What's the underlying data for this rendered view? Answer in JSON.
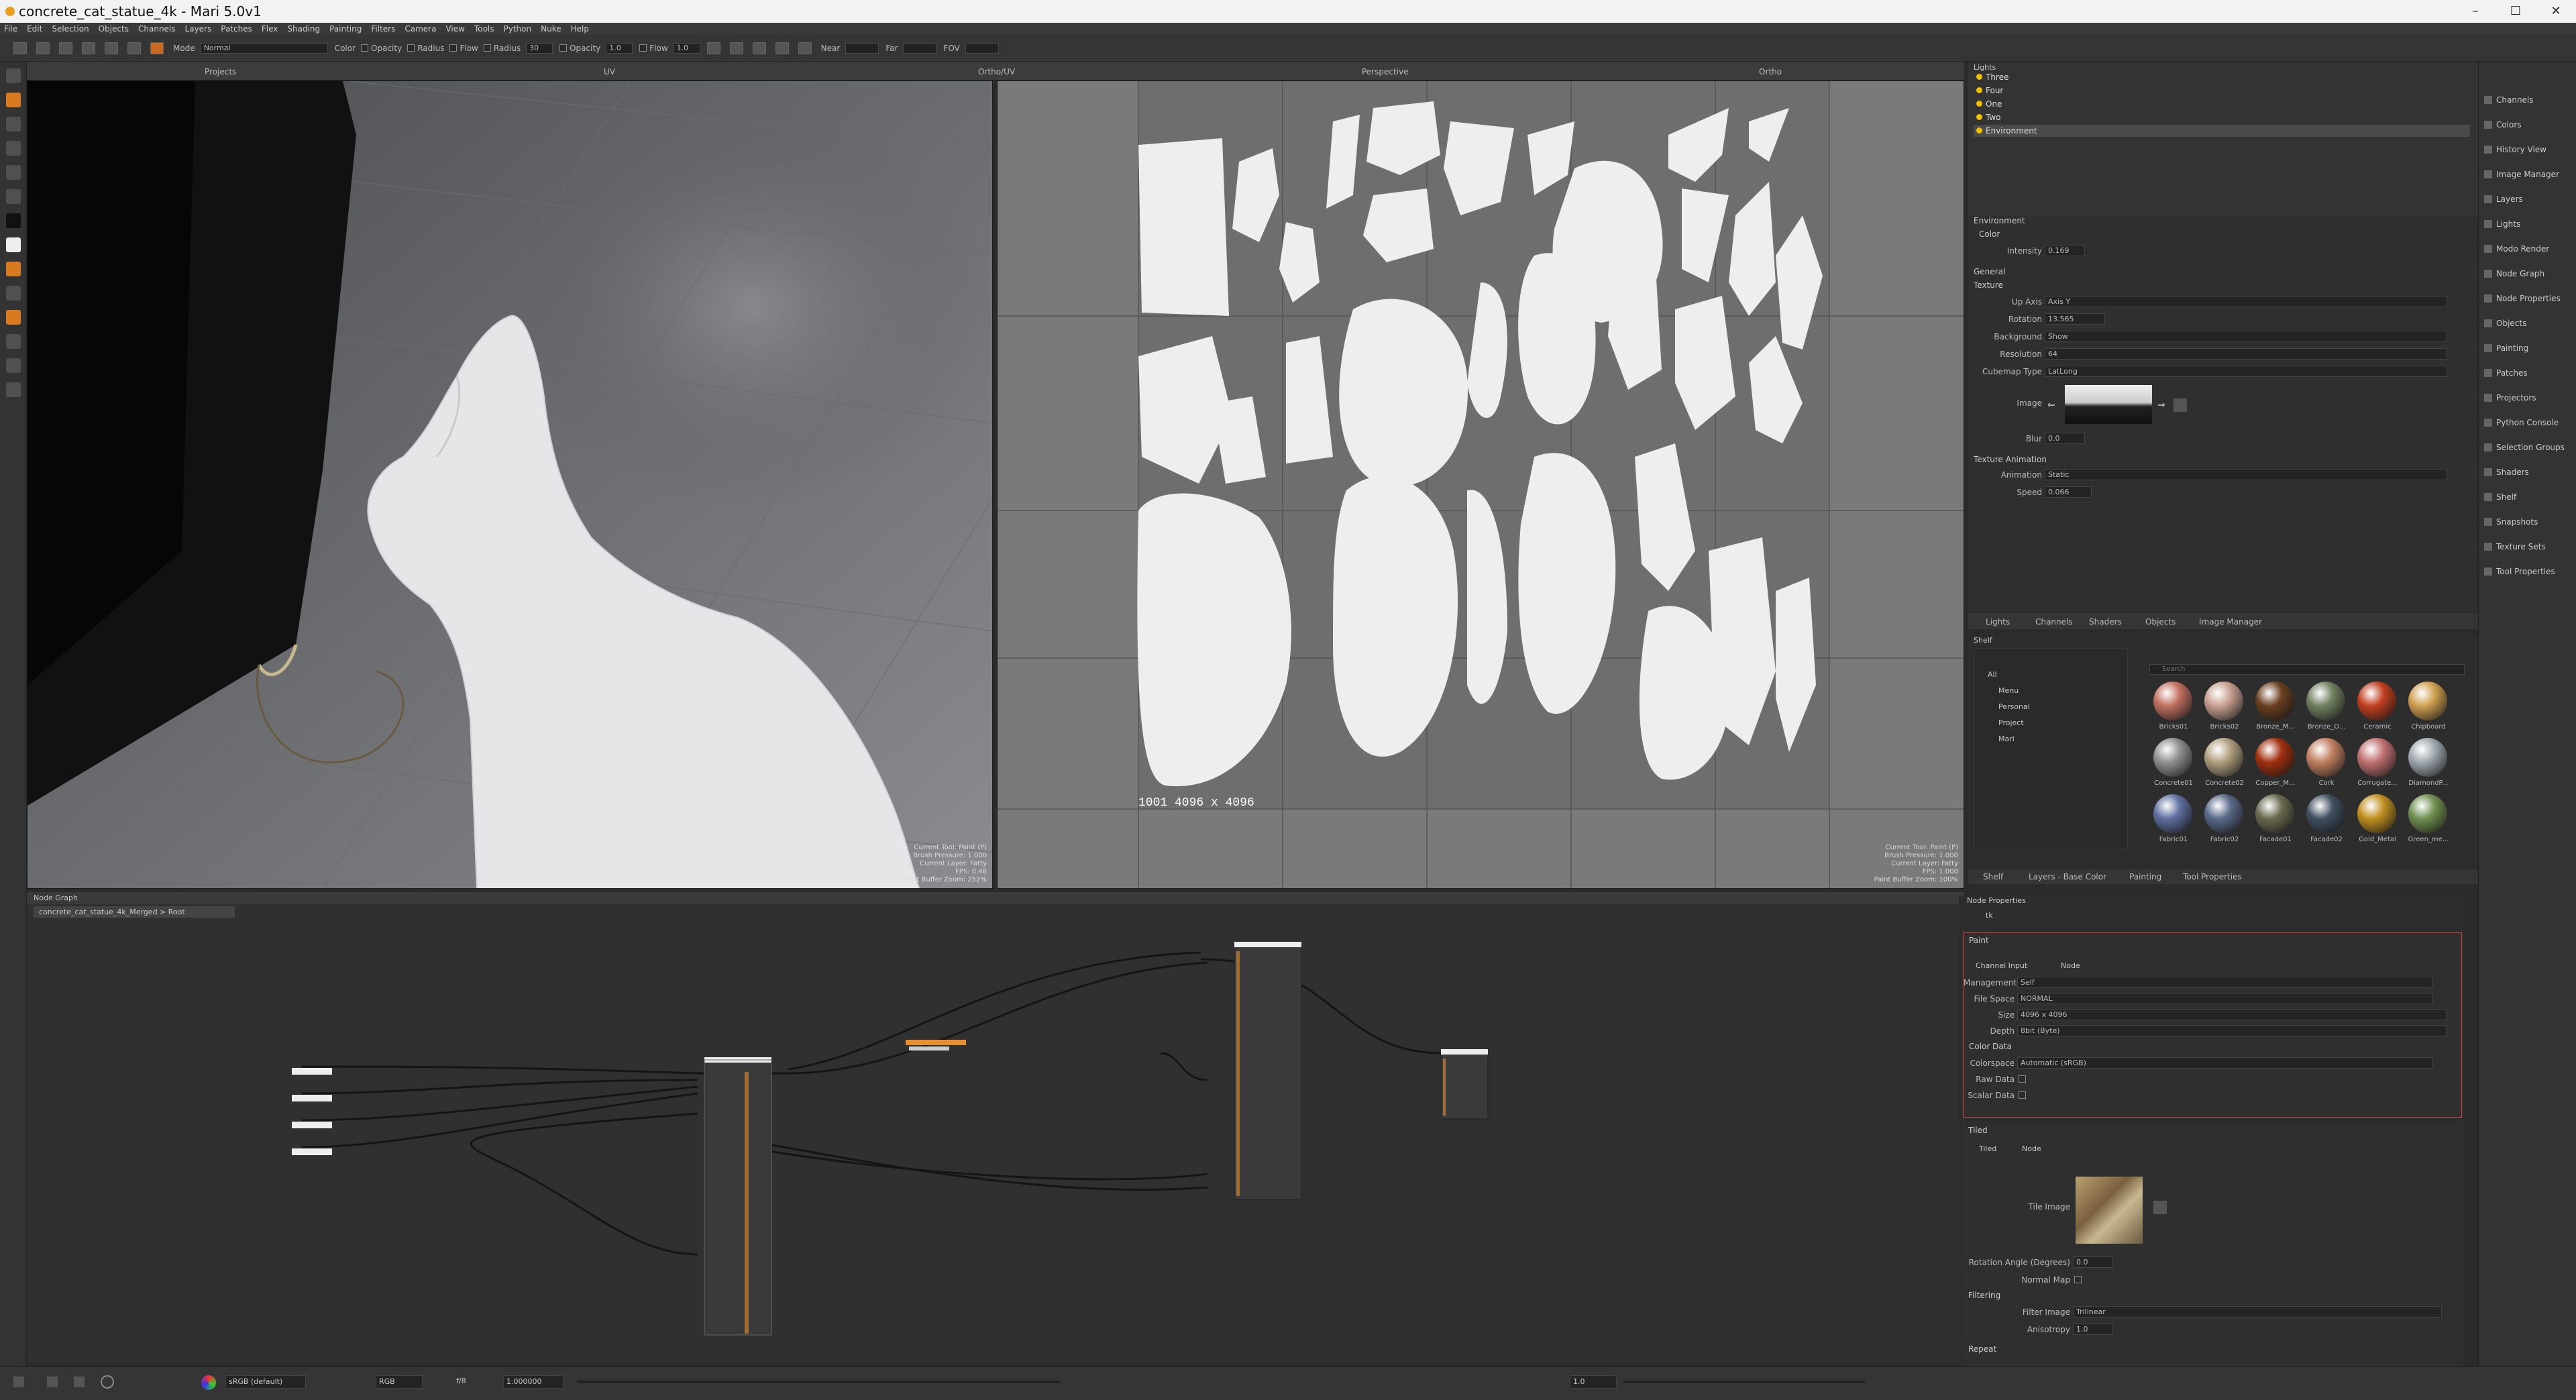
{
  "window": {
    "title": "concrete_cat_statue_4k - Mari 5.0v1",
    "controls": [
      "–",
      "☐",
      "✕"
    ]
  },
  "menu": [
    "File",
    "Edit",
    "Selection",
    "Objects",
    "Channels",
    "Layers",
    "Patches",
    "Flex",
    "Shading",
    "Painting",
    "Filters",
    "Camera",
    "View",
    "Tools",
    "Python",
    "Nuke",
    "Help"
  ],
  "toolbar": {
    "mode_label": "Mode",
    "mode_value": "Normal",
    "color_label": "Color",
    "opacity_label": "Opacity",
    "radius_label": "Radius",
    "flow_label": "Flow",
    "radius2_label": "Radius",
    "radius_value": "30",
    "opacity2_label": "Opacity",
    "opacity_value": "1.0",
    "flow2_label": "Flow",
    "flow_value": "1.0",
    "near_label": "Near",
    "far_label": "Far",
    "fov_label": "FOV"
  },
  "viewport_tabs": [
    "Projects",
    "UV",
    "Ortho/UV",
    "Perspective",
    "Ortho"
  ],
  "viewport3d": {
    "hud": [
      "Current Tool: Paint (P)",
      "Brush Pressure: 1.000",
      "Current Layer: Fatty",
      "FPS: 0.48",
      "Paint Buffer Zoom: 252%"
    ]
  },
  "uvview": {
    "label": "1001  4096  x  4096",
    "hud": [
      "Current Tool: Paint (P)",
      "Brush Pressure: 1.000",
      "Current Layer: Fatty",
      "FPS: 1.000",
      "Paint Buffer Zoom: 100%"
    ]
  },
  "nodegraph": {
    "title": "Node Graph",
    "path": "concrete_cat_statue_4k_Merged > Root"
  },
  "lights": {
    "title": "Lights",
    "items": [
      "Three",
      "Four",
      "One",
      "Two",
      "Environment"
    ]
  },
  "environment": {
    "title": "Environment",
    "color_section": "Color",
    "intensity_label": "Intensity",
    "intensity_value": "0.169",
    "general": "General",
    "texture": "Texture",
    "up_axis_label": "Up Axis",
    "up_axis_value": "Axis Y",
    "rotation_label": "Rotation",
    "rotation_value": "13.565",
    "background_label": "Background",
    "background_value": "Show",
    "resolution_label": "Resolution",
    "resolution_value": "64",
    "cubemap_label": "Cubemap Type",
    "cubemap_value": "LatLong",
    "image_label": "Image",
    "blur_label": "Blur",
    "blur_value": "0.0",
    "tex_anim": "Texture Animation",
    "animation_label": "Animation",
    "animation_value": "Static",
    "speed_label": "Speed",
    "speed_value": "0.066"
  },
  "panel_tabs": [
    "Lights",
    "Channels",
    "Shaders",
    "Objects",
    "Image Manager"
  ],
  "shelf": {
    "title": "Shelf",
    "search_placeholder": "Search",
    "tree": [
      "All",
      "Menu",
      "Personal",
      "Project",
      "Mari"
    ],
    "items": [
      {
        "name": "Bricks01",
        "color": "#c07060"
      },
      {
        "name": "Bricks02",
        "color": "#c8a090"
      },
      {
        "name": "Bronze_M...",
        "color": "#6a4020"
      },
      {
        "name": "Bronze_O...",
        "color": "#708060"
      },
      {
        "name": "Ceramic",
        "color": "#c04020"
      },
      {
        "name": "Chipboard",
        "color": "#d0a050"
      },
      {
        "name": "Concrete01",
        "color": "#909090"
      },
      {
        "name": "Concrete02",
        "color": "#b0a080"
      },
      {
        "name": "Copper_M...",
        "color": "#a03010"
      },
      {
        "name": "Cork",
        "color": "#c08060"
      },
      {
        "name": "Corrugate...",
        "color": "#c07070"
      },
      {
        "name": "DiamondP...",
        "color": "#a0a8b0"
      },
      {
        "name": "Fabric01",
        "color": "#6070a0"
      },
      {
        "name": "Fabric02",
        "color": "#5a6a8a"
      },
      {
        "name": "Facade01",
        "color": "#6a6a50"
      },
      {
        "name": "Facade02",
        "color": "#405060"
      },
      {
        "name": "Gold_Metal",
        "color": "#c09020"
      },
      {
        "name": "Green_me...",
        "color": "#709050"
      }
    ]
  },
  "shelf_tabs": [
    "Shelf",
    "Layers - Base Color",
    "Painting",
    "Tool Properties"
  ],
  "nodeprops": {
    "title": "Node Properties",
    "filter": "tk",
    "paint_title": "Paint",
    "tab_channel": "Channel Input",
    "tab_node": "Node",
    "management_label": "Management",
    "management_value": "Self",
    "filespace_label": "File Space",
    "filespace_value": "NORMAL",
    "size_label": "Size",
    "size_value": "4096 x 4096",
    "depth_label": "Depth",
    "depth_value": "8bit (Byte)",
    "colordata": "Color Data",
    "colorspace_label": "Colorspace",
    "colorspace_value": "Automatic (sRGB)",
    "rawdata_label": "Raw Data",
    "scalardata_label": "Scalar Data",
    "tiled_title": "Tiled",
    "tiled_tab": "Tiled",
    "tiled_node": "Node",
    "tile_image_label": "Tile Image",
    "rotation_label": "Rotation Angle (Degrees)",
    "rotation_value": "0.0",
    "normalmap_label": "Normal Map",
    "filtering": "Filtering",
    "filter_image_label": "Filter Image",
    "filter_image_value": "Trilinear",
    "anisotropy_label": "Anisotropy",
    "anisotropy_value": "1.0",
    "repeat": "Repeat"
  },
  "rightbar": [
    "Channels",
    "Colors",
    "History View",
    "Image Manager",
    "Layers",
    "Lights",
    "Modo Render",
    "Node Graph",
    "Node Properties",
    "Objects",
    "Painting",
    "Patches",
    "Projectors",
    "Python Console",
    "Selection Groups",
    "Shaders",
    "Shelf",
    "Snapshots",
    "Texture Sets",
    "Tool Properties"
  ],
  "status": {
    "colorspace": "sRGB (default)",
    "channels": "RGB",
    "fstop": "f/8",
    "gain": "1.000000",
    "gamma": "1.0"
  }
}
